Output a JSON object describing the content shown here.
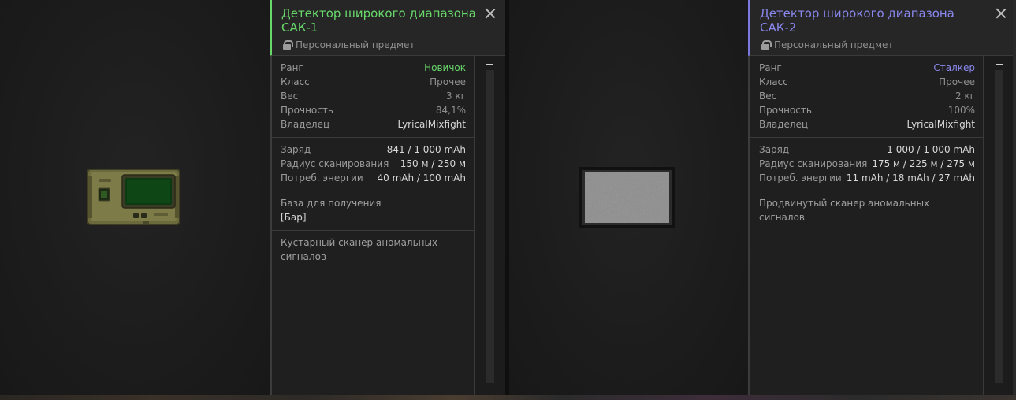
{
  "colors": {
    "rank_novice": "#69d86b",
    "rank_stalker": "#8a87ee",
    "accent_left": "#69d86b",
    "accent_right": "#7b78e0"
  },
  "items": [
    {
      "title_line1": "Детектор широкого диапазона",
      "title_line2": "САК-1",
      "subtitle": "Персональный предмет",
      "lock_icon": "lock-icon",
      "close_icon": "close-icon",
      "stats": [
        {
          "label": "Ранг",
          "value": "Новичок"
        },
        {
          "label": "Класс",
          "value": "Прочее"
        },
        {
          "label": "Вес",
          "value": "3 кг"
        },
        {
          "label": "Прочность",
          "value": "84,1%"
        },
        {
          "label": "Владелец",
          "value": "LyricalMixfight"
        }
      ],
      "specs": [
        {
          "label": "Заряд",
          "value": "841 / 1 000 mAh"
        },
        {
          "label": "Радиус сканирования",
          "value": "150 м / 250 м"
        },
        {
          "label": "Потреб. энергии",
          "value": "40 mAh / 100 mAh"
        }
      ],
      "base_label": "База для получения",
      "base_value": "[Бар]",
      "description": "Кустарный сканер аномальных сигналов"
    },
    {
      "title_line1": "Детектор широкого диапазона",
      "title_line2": "САК-2",
      "subtitle": "Персональный предмет",
      "lock_icon": "lock-icon",
      "close_icon": "close-icon",
      "stats": [
        {
          "label": "Ранг",
          "value": "Сталкер"
        },
        {
          "label": "Класс",
          "value": "Прочее"
        },
        {
          "label": "Вес",
          "value": "2 кг"
        },
        {
          "label": "Прочность",
          "value": "100%"
        },
        {
          "label": "Владелец",
          "value": "LyricalMixfight"
        }
      ],
      "specs": [
        {
          "label": "Заряд",
          "value": "1 000 / 1 000 mAh"
        },
        {
          "label": "Радиус сканирования",
          "value": "175 м / 225 м / 275 м"
        },
        {
          "label": "Потреб. энергии",
          "value": "11 mAh / 18 mAh / 27 mAh"
        }
      ],
      "description": "Продвинутый сканер аномальных сигналов"
    }
  ]
}
